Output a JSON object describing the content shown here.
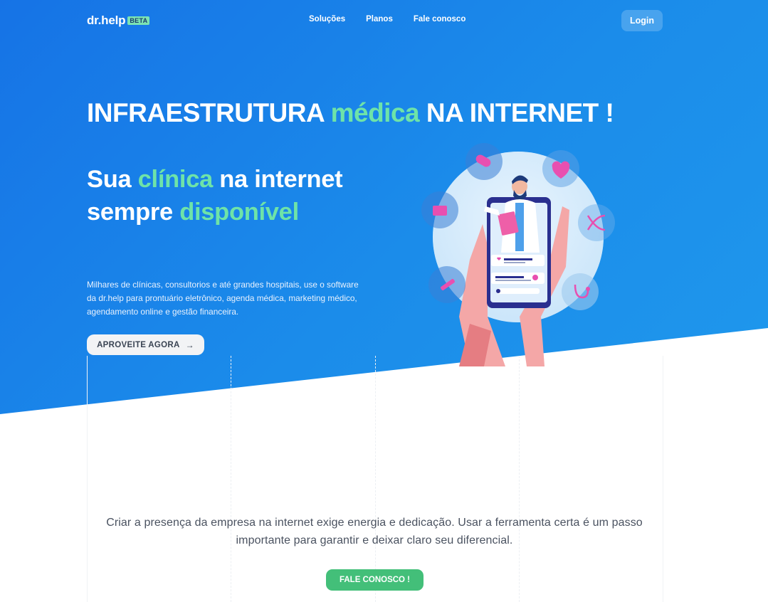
{
  "brand": {
    "name": "dr.help",
    "badge": "BETA"
  },
  "nav": {
    "links": [
      "Soluções",
      "Planos",
      "Fale conosco"
    ],
    "login": "Login"
  },
  "hero": {
    "headline_pre": "INFRAESTRUTURA ",
    "headline_accent": "médica",
    "headline_post": " NA INTERNET !",
    "subhead_pre": "Sua ",
    "subhead_accent1": "clínica",
    "subhead_mid": " na internet sempre ",
    "subhead_accent2": "disponível",
    "description": "Milhares de clínicas, consultorios e até grandes hospitais, use o software da dr.help para prontuário eletrônico, agenda médica, marketing médico, agendamento online e gestão financeira.",
    "cta": "APROVEITE AGORA",
    "cta_icon": "arrow-right-icon"
  },
  "lower": {
    "text": "Criar a presença da empresa na internet exige energia e dedicação. Usar a ferramenta certa é um passo importante para garantir e deixar claro seu diferencial.",
    "button": "FALE CONOSCO !"
  },
  "colors": {
    "hero_blue": "#1673e6",
    "accent_green": "#6ee3a8",
    "button_green": "#43bf79",
    "icon_pink": "#e84fb0"
  }
}
